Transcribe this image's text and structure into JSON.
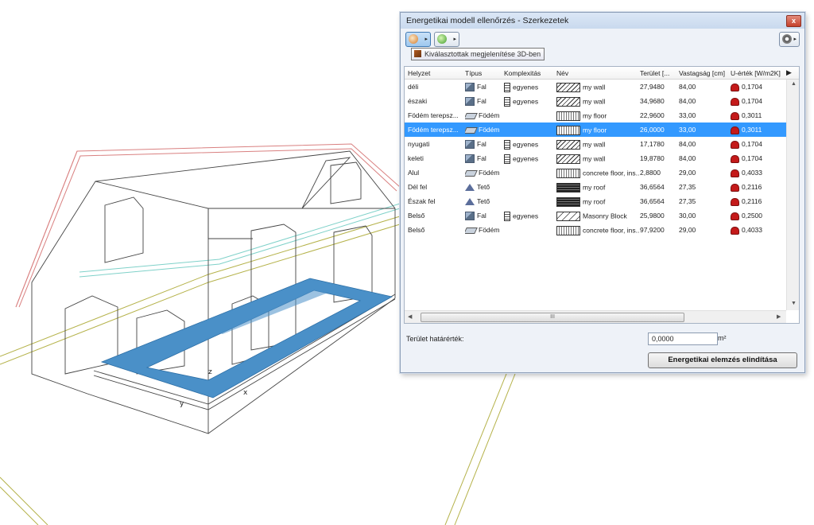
{
  "window": {
    "title": "Energetikai modell ellenőrzés - Szerkezetek",
    "close_glyph": "x"
  },
  "toolbar": {
    "settings_icon": "gear-icon",
    "tooltip": "Kiválasztottak megjelenítése 3D-ben"
  },
  "table": {
    "columns": [
      "Helyzet",
      "Típus",
      "Komplexitás",
      "Név",
      "Terület [...",
      "Vastagság [cm]",
      "U-érték [W/m2K]"
    ],
    "rows": [
      {
        "helyzet": "déli",
        "tipus": "Fal",
        "komplexitas": "egyenes",
        "nev": "my wall",
        "terulet": "27,9480",
        "vastagsag": "84,00",
        "u": "0,1704",
        "selected": false
      },
      {
        "helyzet": "északi",
        "tipus": "Fal",
        "komplexitas": "egyenes",
        "nev": "my wall",
        "terulet": "34,9680",
        "vastagsag": "84,00",
        "u": "0,1704",
        "selected": false
      },
      {
        "helyzet": "Födém terepsz...",
        "tipus": "Födém",
        "komplexitas": "",
        "nev": "my floor",
        "terulet": "22,9600",
        "vastagsag": "33,00",
        "u": "0,3011",
        "selected": false
      },
      {
        "helyzet": "Födém terepsz...",
        "tipus": "Födém",
        "komplexitas": "",
        "nev": "my floor",
        "terulet": "26,0000",
        "vastagsag": "33,00",
        "u": "0,3011",
        "selected": true
      },
      {
        "helyzet": "nyugati",
        "tipus": "Fal",
        "komplexitas": "egyenes",
        "nev": "my wall",
        "terulet": "17,1780",
        "vastagsag": "84,00",
        "u": "0,1704",
        "selected": false
      },
      {
        "helyzet": "keleti",
        "tipus": "Fal",
        "komplexitas": "egyenes",
        "nev": "my wall",
        "terulet": "19,8780",
        "vastagsag": "84,00",
        "u": "0,1704",
        "selected": false
      },
      {
        "helyzet": "Alul",
        "tipus": "Födém",
        "komplexitas": "",
        "nev": "concrete floor, ins...",
        "terulet": "2,8800",
        "vastagsag": "29,00",
        "u": "0,4033",
        "selected": false
      },
      {
        "helyzet": "Dél fel",
        "tipus": "Tető",
        "komplexitas": "",
        "nev": "my roof",
        "terulet": "36,6564",
        "vastagsag": "27,35",
        "u": "0,2116",
        "selected": false
      },
      {
        "helyzet": "Észak fel",
        "tipus": "Tető",
        "komplexitas": "",
        "nev": "my roof",
        "terulet": "36,6564",
        "vastagsag": "27,35",
        "u": "0,2116",
        "selected": false
      },
      {
        "helyzet": "Belső",
        "tipus": "Fal",
        "komplexitas": "egyenes",
        "nev": "Masonry Block",
        "terulet": "25,9800",
        "vastagsag": "30,00",
        "u": "0,2500",
        "selected": false
      },
      {
        "helyzet": "Belső",
        "tipus": "Födém",
        "komplexitas": "",
        "nev": "concrete floor, ins...",
        "terulet": "97,9200",
        "vastagsag": "29,00",
        "u": "0,4033",
        "selected": false
      }
    ],
    "hscroll_grip": "III"
  },
  "limit": {
    "label": "Terület határérték:",
    "value": "0,0000",
    "unit": "m²"
  },
  "actions": {
    "start_label": "Energetikai elemzés elindítása"
  },
  "viewport": {
    "axis_x": "x",
    "axis_y": "y",
    "axis_z": "z"
  },
  "colors": {
    "selection": "#3399ff",
    "slab": "#4a90c8",
    "roof_outline": "#d98080",
    "ground_lines": "#b5b24a"
  }
}
